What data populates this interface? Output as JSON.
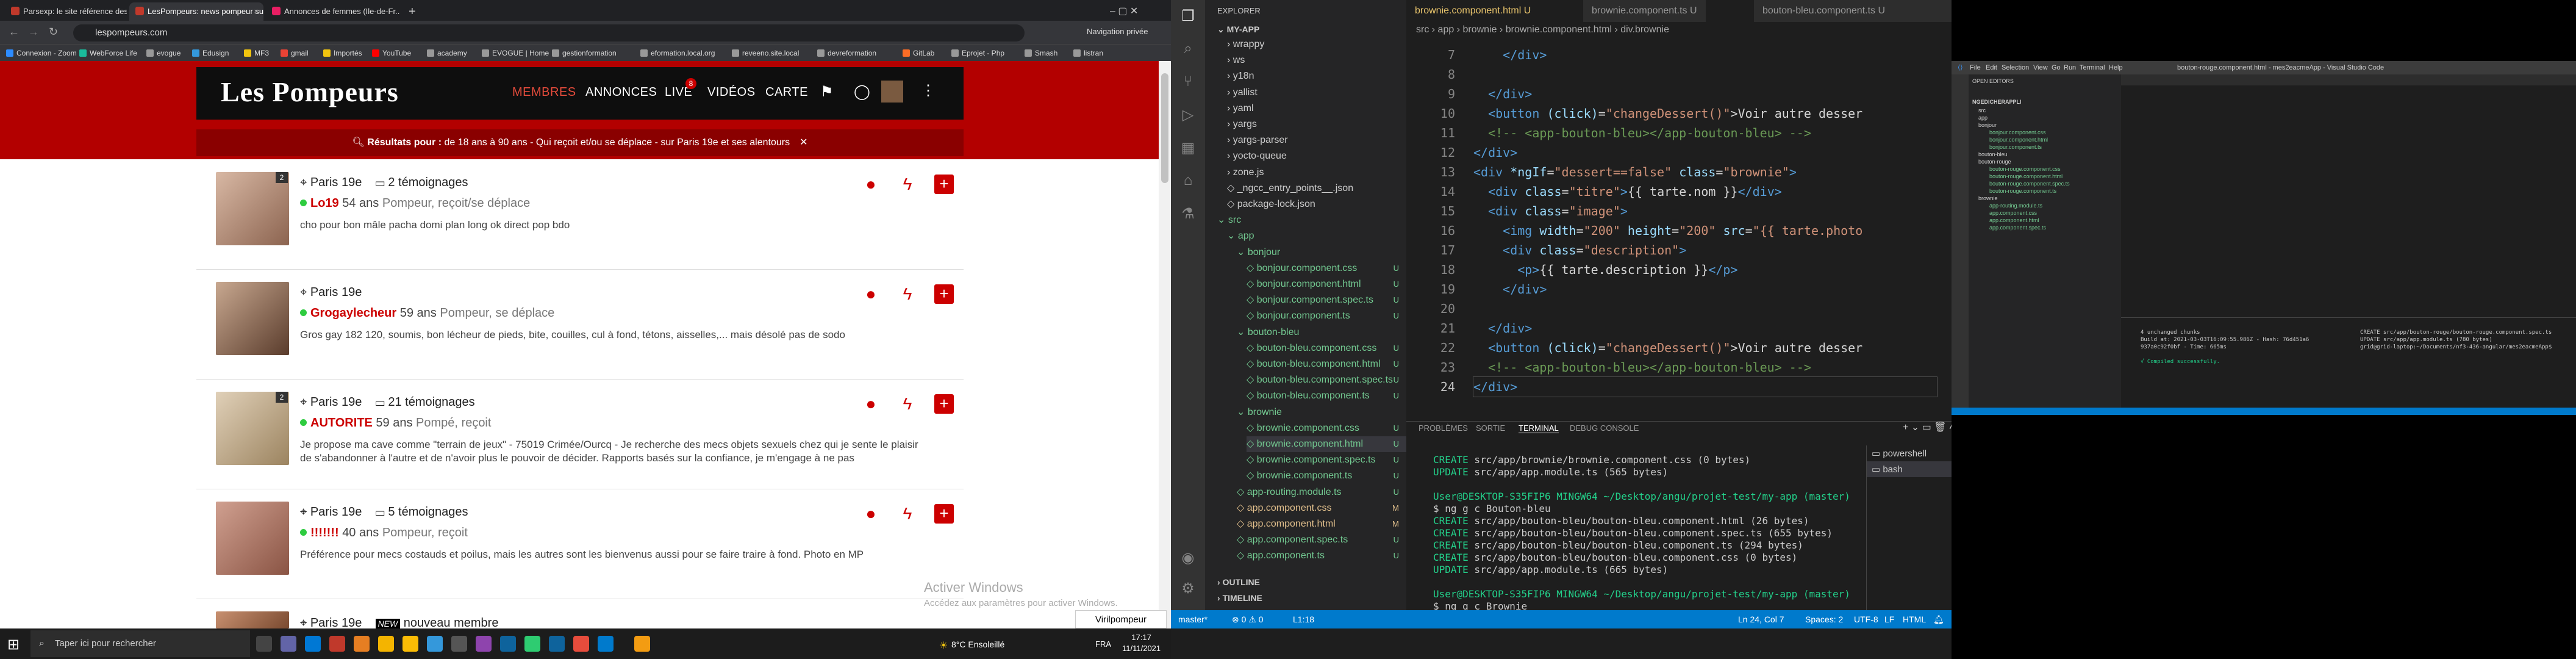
{
  "browser": {
    "tabs": [
      {
        "title": "Parsexp: le site référence des se..."
      },
      {
        "title": "LesPompeurs: news pompeur su..."
      },
      {
        "title": "Annonces de femmes (Ile-de-Fr..."
      }
    ],
    "url": "lespompeurs.com",
    "guest_label": "Navigation privée",
    "bookmarks": [
      "Connexion - Zoom",
      "WebForce Life",
      "evogue",
      "Edusign",
      "MF3",
      "gmail",
      "Importés",
      "YouTube",
      "academy",
      "EVOGUE | Home",
      "gestionformation",
      "eformation.local.org",
      "reveeno.site.local",
      "devreformation",
      "GitLab",
      "Eprojet - Php",
      "Smash",
      "listran"
    ]
  },
  "site": {
    "logo": "Les Pompeurs",
    "nav": [
      "MEMBRES",
      "ANNONCES",
      "LIVE",
      "VIDÉOS",
      "CARTE"
    ],
    "live_badge": "8",
    "filter_bold": "Résultats pour :",
    "filter_text": " de 18 ans à 90 ans - Qui reçoit et/ou se déplace - sur Paris 19e et ses alentours",
    "profiles": [
      {
        "count": "2",
        "city": "Paris 19e",
        "testimonials": "2 témoignages",
        "name": "Lo19",
        "age": "54 ans",
        "role": "Pompeur, reçoit/se déplace",
        "desc": "cho pour bon mâle pacha domi plan long ok direct pop bdo"
      },
      {
        "count": "",
        "city": "Paris 19e",
        "testimonials": "",
        "name": "Grogaylecheur",
        "age": "59 ans",
        "role": "Pompeur, se déplace",
        "desc": "Gros gay 182 120, soumis, bon lécheur de pieds, bite, couilles, cul à fond, tétons, aisselles,... mais désolé pas de sodo"
      },
      {
        "count": "2",
        "city": "Paris 19e",
        "testimonials": "21 témoignages",
        "name": "AUTORITE",
        "age": "59 ans",
        "role": "Pompé, reçoit",
        "desc": "Je propose ma cave comme \"terrain de jeux\" - 75019 Crimée/Ourcq - Je recherche des mecs objets sexuels chez qui je sente le plaisir de s'abandonner à l'autre et de n'avoir plus le pouvoir de décider. Rapports basés sur la confiance, je m'engage à ne pas"
      },
      {
        "count": "",
        "city": "Paris 19e",
        "testimonials": "5 témoignages",
        "name": "!!!!!!!",
        "age": "40 ans",
        "role": "Pompeur, reçoit",
        "desc": "Préférence pour mecs costauds et poilus, mais les autres sont les bienvenus aussi pour se faire traire à fond. Photo en MP"
      },
      {
        "count": "",
        "city": "Paris 19e",
        "testimonials": "nouveau membre",
        "new_badge": "NEW",
        "name": "",
        "age": "",
        "role": "",
        "desc": ""
      }
    ],
    "activate_title": "Activer Windows",
    "activate_sub": "Accédez aux paramètres pour activer Windows.",
    "notif": "Virilpompeur"
  },
  "taskbar": {
    "search_placeholder": "Taper ici pour rechercher",
    "weather": "8°C  Ensoleillé",
    "lang": "FRA",
    "time": "17:17",
    "date": "11/11/2021"
  },
  "vscode": {
    "explorer_title": "EXPLORER",
    "project": "MY-APP",
    "tree": [
      {
        "label": "wrappy",
        "indent": 1,
        "type": "folder"
      },
      {
        "label": "ws",
        "indent": 1,
        "type": "folder"
      },
      {
        "label": "y18n",
        "indent": 1,
        "type": "folder"
      },
      {
        "label": "yallist",
        "indent": 1,
        "type": "folder"
      },
      {
        "label": "yaml",
        "indent": 1,
        "type": "folder"
      },
      {
        "label": "yargs",
        "indent": 1,
        "type": "folder"
      },
      {
        "label": "yargs-parser",
        "indent": 1,
        "type": "folder"
      },
      {
        "label": "yocto-queue",
        "indent": 1,
        "type": "folder"
      },
      {
        "label": "zone.js",
        "indent": 1,
        "type": "folder"
      },
      {
        "label": "_ngcc_entry_points__.json",
        "indent": 1,
        "type": "file"
      },
      {
        "label": "package-lock.json",
        "indent": 1,
        "type": "file"
      },
      {
        "label": "src",
        "indent": 0,
        "type": "folder-open",
        "status": "u"
      },
      {
        "label": "app",
        "indent": 1,
        "type": "folder-open",
        "status": "u"
      },
      {
        "label": "bonjour",
        "indent": 2,
        "type": "folder-open",
        "status": "u"
      },
      {
        "label": "bonjour.component.css",
        "indent": 3,
        "type": "file",
        "status": "u",
        "git": "U"
      },
      {
        "label": "bonjour.component.html",
        "indent": 3,
        "type": "file",
        "status": "u",
        "git": "U"
      },
      {
        "label": "bonjour.component.spec.ts",
        "indent": 3,
        "type": "file",
        "status": "u",
        "git": "U"
      },
      {
        "label": "bonjour.component.ts",
        "indent": 3,
        "type": "file",
        "status": "u",
        "git": "U"
      },
      {
        "label": "bouton-bleu",
        "indent": 2,
        "type": "folder-open",
        "status": "u"
      },
      {
        "label": "bouton-bleu.component.css",
        "indent": 3,
        "type": "file",
        "status": "u",
        "git": "U"
      },
      {
        "label": "bouton-bleu.component.html",
        "indent": 3,
        "type": "file",
        "status": "u",
        "git": "U"
      },
      {
        "label": "bouton-bleu.component.spec.ts",
        "indent": 3,
        "type": "file",
        "status": "u",
        "git": "U"
      },
      {
        "label": "bouton-bleu.component.ts",
        "indent": 3,
        "type": "file",
        "status": "u",
        "git": "U"
      },
      {
        "label": "brownie",
        "indent": 2,
        "type": "folder-open",
        "status": "u"
      },
      {
        "label": "brownie.component.css",
        "indent": 3,
        "type": "file",
        "status": "u",
        "git": "U"
      },
      {
        "label": "brownie.component.html",
        "indent": 3,
        "type": "file",
        "status": "u",
        "git": "U",
        "selected": true
      },
      {
        "label": "brownie.component.spec.ts",
        "indent": 3,
        "type": "file",
        "status": "u",
        "git": "U"
      },
      {
        "label": "brownie.component.ts",
        "indent": 3,
        "type": "file",
        "status": "u",
        "git": "U"
      },
      {
        "label": "app-routing.module.ts",
        "indent": 2,
        "type": "file",
        "status": "u",
        "git": "U"
      },
      {
        "label": "app.component.css",
        "indent": 2,
        "type": "file",
        "status": "m",
        "git": "M"
      },
      {
        "label": "app.component.html",
        "indent": 2,
        "type": "file",
        "status": "m",
        "git": "M"
      },
      {
        "label": "app.component.spec.ts",
        "indent": 2,
        "type": "file",
        "status": "u",
        "git": "U"
      },
      {
        "label": "app.component.ts",
        "indent": 2,
        "type": "file",
        "status": "u",
        "git": "U"
      }
    ],
    "outline": "OUTLINE",
    "timeline": "TIMELINE",
    "tabs": [
      "brownie.component.html U",
      "brownie.component.ts U",
      "bouton-bleu.component.ts U"
    ],
    "breadcrumb": "src › app › brownie › brownie.component.html › div.brownie",
    "line_numbers": [
      "7",
      "8",
      "9",
      "10",
      "11",
      "12",
      "13",
      "14",
      "15",
      "16",
      "17",
      "18",
      "19",
      "20",
      "21",
      "22",
      "23",
      "24"
    ],
    "panel_tabs": [
      "PROBLÈMES",
      "SORTIE",
      "TERMINAL",
      "DEBUG CONSOLE"
    ],
    "terminal": [
      "CREATE src/app/brownie/brownie.component.css (0 bytes)",
      "UPDATE src/app/app.module.ts (565 bytes)",
      "",
      "User@DESKTOP-S35FIP6 MINGW64 ~/Desktop/angu/projet-test/my-app (master)",
      "$ ng g c Bouton-bleu",
      "CREATE src/app/bouton-bleu/bouton-bleu.component.html (26 bytes)",
      "CREATE src/app/bouton-bleu/bouton-bleu.component.spec.ts (655 bytes)",
      "CREATE src/app/bouton-bleu/bouton-bleu.component.ts (294 bytes)",
      "CREATE src/app/bouton-bleu/bouton-bleu.component.css (0 bytes)",
      "UPDATE src/app/app.module.ts (665 bytes)",
      "",
      "User@DESKTOP-S35FIP6 MINGW64 ~/Desktop/angu/projet-test/my-app (master)",
      "$ ng g c Brownie"
    ],
    "terminal_list": [
      "powershell",
      "bash"
    ],
    "status_left": [
      "master*",
      "⊗ 0 ⚠ 0",
      "L1:18"
    ],
    "status_right": [
      "Ln 24, Col 7",
      "Spaces: 2",
      "UTF-8",
      "LF",
      "HTML"
    ]
  },
  "vscode2": {
    "title": "bouton-rouge.component.html - mes2eacmeApp - Visual Studio Code",
    "menu": [
      "File",
      "Edit",
      "Selection",
      "View",
      "Go",
      "Run",
      "Terminal",
      "Help"
    ],
    "open_editors": "OPEN EDITORS",
    "project": "NGEDICHERAPPLI",
    "files": [
      "src",
      "app",
      "bonjour",
      "bonjour.component.css",
      "bonjour.component.html",
      "bonjour.component.ts",
      "bouton-bleu",
      "bouton-rouge",
      "bouton-rouge.component.css",
      "bouton-rouge.component.html",
      "bouton-rouge.component.spec.ts",
      "bouton-rouge.component.ts",
      "brownie",
      "app-routing.module.ts",
      "app.component.css",
      "app.component.html",
      "app.component.spec.ts"
    ],
    "term_lines": [
      "4 unchanged chunks",
      "Build at: 2021-03-03T16:09:55.986Z - Hash: 76d451a6",
      "937a0c92f0bf - Time: 665ms",
      "",
      "√ Compiled successfully."
    ],
    "term_right": [
      "CREATE src/app/bouton-rouge/bouton-rouge.component.spec.ts",
      "UPDATE src/app/app.module.ts (780 bytes)",
      "grid@grid-laptop:~/Documents/nf3-436-angular/mes2eacmeApp$"
    ]
  }
}
